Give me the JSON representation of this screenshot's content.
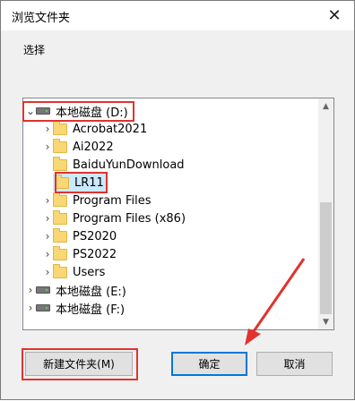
{
  "window": {
    "title": "浏览文件夹",
    "close_label": "✕"
  },
  "instruction": "选择",
  "tree": {
    "items": [
      {
        "label": "本地磁盘 (D:)",
        "type": "drive",
        "level": 0,
        "expanded": true,
        "chev": "⌄"
      },
      {
        "label": "Acrobat2021",
        "type": "folder",
        "level": 1,
        "chev": "›"
      },
      {
        "label": "Ai2022",
        "type": "folder",
        "level": 1,
        "chev": "›"
      },
      {
        "label": "BaiduYunDownload",
        "type": "folder",
        "level": 1,
        "chev": ""
      },
      {
        "label": "LR11",
        "type": "folder",
        "level": 1,
        "chev": "",
        "selected": true
      },
      {
        "label": "Program Files",
        "type": "folder",
        "level": 1,
        "chev": "›"
      },
      {
        "label": "Program Files (x86)",
        "type": "folder",
        "level": 1,
        "chev": "›"
      },
      {
        "label": "PS2020",
        "type": "folder",
        "level": 1,
        "chev": "›"
      },
      {
        "label": "PS2022",
        "type": "folder",
        "level": 1,
        "chev": "›"
      },
      {
        "label": "Users",
        "type": "folder",
        "level": 1,
        "chev": "›"
      },
      {
        "label": "本地磁盘 (E:)",
        "type": "drive",
        "level": 0,
        "chev": "›"
      },
      {
        "label": "本地磁盘 (F:)",
        "type": "drive",
        "level": 0,
        "chev": "›"
      }
    ]
  },
  "buttons": {
    "new_folder": "新建文件夹(M)",
    "ok": "确定",
    "cancel": "取消"
  },
  "colors": {
    "highlight": "#e0332f",
    "selection": "#cce8ff",
    "primary_border": "#0078d7"
  }
}
